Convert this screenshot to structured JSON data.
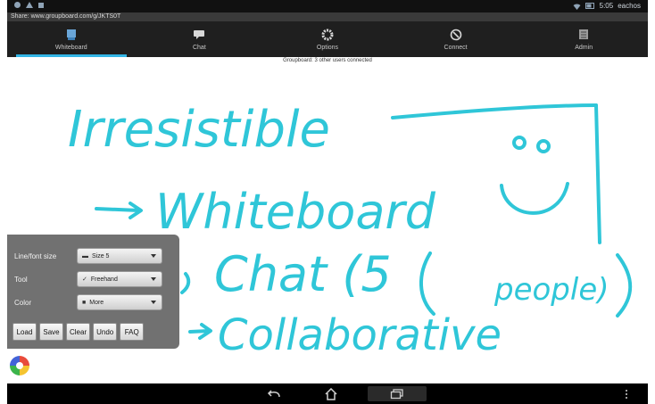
{
  "status_bar": {
    "time": "5:05",
    "carrier": "eachos",
    "icons": [
      "notification-dot-icon",
      "warning-icon",
      "image-icon",
      "wifi-icon",
      "battery-icon"
    ]
  },
  "share_bar": {
    "text": "Share: www.groupboard.com/g/JKTS0T"
  },
  "tabs": [
    {
      "label": "Whiteboard",
      "icon": "whiteboard-icon",
      "active": true
    },
    {
      "label": "Chat",
      "icon": "chat-bubble-icon",
      "active": false
    },
    {
      "label": "Options",
      "icon": "gear-icon",
      "active": false
    },
    {
      "label": "Connect",
      "icon": "connect-icon",
      "active": false
    },
    {
      "label": "Admin",
      "icon": "admin-icon",
      "active": false
    }
  ],
  "status_text": "Groupboard: 3 other users connected",
  "drawing": {
    "ink_color": "#2fc6d8",
    "words": [
      "Irresistible",
      "Whiteboard",
      "Chat (5",
      "people)",
      "Collaborative"
    ]
  },
  "tool_panel": {
    "line_size_label": "Line/font size",
    "line_size_value": "Size 5",
    "tool_label": "Tool",
    "tool_value": "Freehand",
    "color_label": "Color",
    "color_value": "More",
    "buttons": [
      "Load",
      "Save",
      "Clear",
      "Undo",
      "FAQ"
    ]
  },
  "navbar": {
    "icons": [
      "back-icon",
      "home-icon",
      "recents-icon",
      "menu-icon"
    ]
  }
}
